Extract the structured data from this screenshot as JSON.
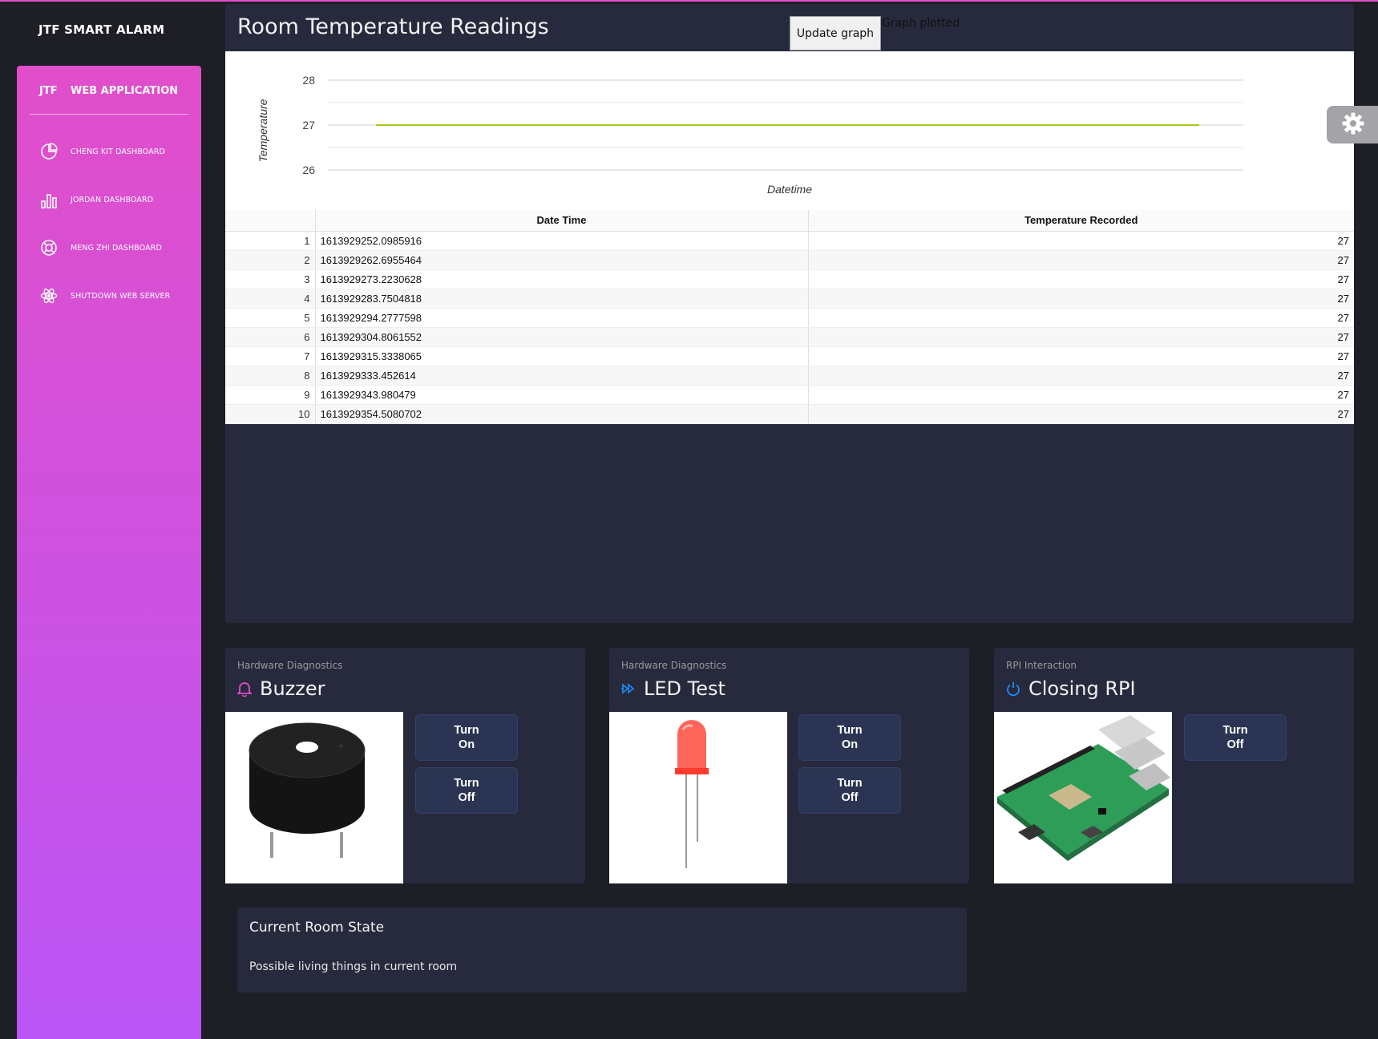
{
  "brand": "JTF SMART ALARM",
  "sidebar": {
    "short": "JTF",
    "long": "WEB APPLICATION",
    "items": [
      {
        "label": "CHENG KIT DASHBOARD",
        "icon": "pie-chart-icon"
      },
      {
        "label": "JORDAN DASHBOARD",
        "icon": "bar-chart-icon"
      },
      {
        "label": "MENG ZHI DASHBOARD",
        "icon": "life-ring-icon"
      },
      {
        "label": "SHUTDOWN WEB SERVER",
        "icon": "atom-icon"
      }
    ]
  },
  "header": {
    "title": "Room Temperature Readings",
    "update_label": "Update graph",
    "status": "Graph plotted"
  },
  "chart_data": {
    "type": "line",
    "xlabel": "Datetime",
    "ylabel": "Temperature",
    "ylim": [
      26,
      28
    ],
    "yticks": [
      26,
      27,
      28
    ],
    "grid": true,
    "series": [
      {
        "values": [
          27,
          27,
          27,
          27,
          27,
          27,
          27,
          27,
          27,
          27
        ],
        "color": "#a6cc1a"
      }
    ]
  },
  "table": {
    "columns": [
      "",
      "Date Time",
      "Temperature Recorded"
    ],
    "rows": [
      {
        "idx": "1",
        "datetime": "1613929252.0985916",
        "temp": "27"
      },
      {
        "idx": "2",
        "datetime": "1613929262.6955464",
        "temp": "27"
      },
      {
        "idx": "3",
        "datetime": "1613929273.2230628",
        "temp": "27"
      },
      {
        "idx": "4",
        "datetime": "1613929283.7504818",
        "temp": "27"
      },
      {
        "idx": "5",
        "datetime": "1613929294.2777598",
        "temp": "27"
      },
      {
        "idx": "6",
        "datetime": "1613929304.8061552",
        "temp": "27"
      },
      {
        "idx": "7",
        "datetime": "1613929315.3338065",
        "temp": "27"
      },
      {
        "idx": "8",
        "datetime": "1613929333.452614",
        "temp": "27"
      },
      {
        "idx": "9",
        "datetime": "1613929343.980479",
        "temp": "27"
      },
      {
        "idx": "10",
        "datetime": "1613929354.5080702",
        "temp": "27"
      }
    ]
  },
  "cards": {
    "buzzer": {
      "category": "Hardware Diagnostics",
      "title": "Buzzer",
      "icon": "bell-icon",
      "on": "Turn On",
      "off": "Turn Off"
    },
    "led": {
      "category": "Hardware Diagnostics",
      "title": "LED Test",
      "icon": "fast-forward-icon",
      "on": "Turn On",
      "off": "Turn Off"
    },
    "rpi": {
      "category": "RPI Interaction",
      "title": "Closing RPI",
      "icon": "power-icon",
      "off": "Turn Off"
    }
  },
  "room_state": {
    "title": "Current Room State",
    "body": "Possible living things in current room"
  },
  "colors": {
    "accent": "#e14eca",
    "accent2": "#ba54f5",
    "card": "#27293d",
    "button": "#2b3553"
  }
}
